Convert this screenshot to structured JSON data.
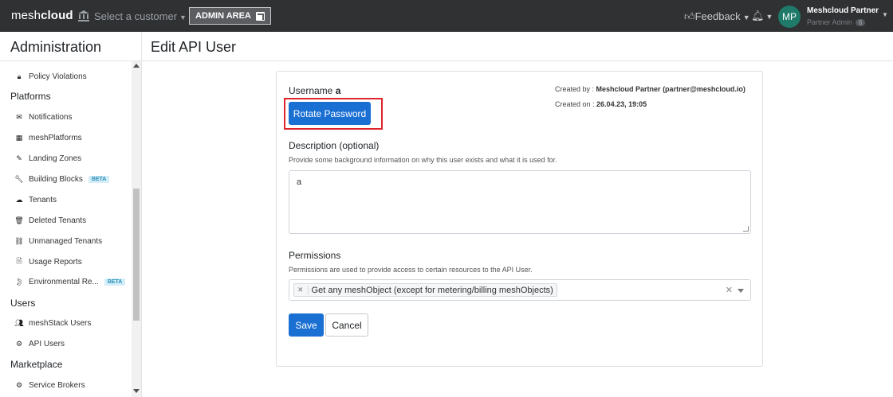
{
  "topbar": {
    "brand_light": "mesh",
    "brand_bold": "cloud",
    "customer_select": "Select a customer",
    "admin_area": "ADMIN AREA",
    "feedback": "Feedback",
    "avatar_initials": "MP",
    "user_name": "Meshcloud Partner",
    "user_role": "Partner Admin",
    "user_badge": "6",
    "bg_color": "#2f3133"
  },
  "sidebar": {
    "title": "Administration",
    "items": [
      {
        "label": "Policy Violations",
        "icon": "lock-icon"
      },
      {
        "section": "Platforms"
      },
      {
        "label": "Notifications",
        "icon": "envelope-icon"
      },
      {
        "label": "meshPlatforms",
        "icon": "grid-icon"
      },
      {
        "label": "Landing Zones",
        "icon": "edit-icon"
      },
      {
        "label": "Building Blocks",
        "icon": "wrench-icon",
        "badge": "BETA"
      },
      {
        "label": "Tenants",
        "icon": "cloud-icon"
      },
      {
        "label": "Deleted Tenants",
        "icon": "trash-icon"
      },
      {
        "label": "Unmanaged Tenants",
        "icon": "unlink-icon"
      },
      {
        "label": "Usage Reports",
        "icon": "file-icon"
      },
      {
        "label": "Environmental Re...",
        "icon": "leaf-icon",
        "badge": "BETA"
      },
      {
        "section": "Users"
      },
      {
        "label": "meshStack Users",
        "icon": "users-icon"
      },
      {
        "label": "API Users",
        "icon": "robot-icon"
      },
      {
        "section": "Marketplace"
      },
      {
        "label": "Service Brokers",
        "icon": "cogs-icon"
      }
    ]
  },
  "page": {
    "title": "Edit API User",
    "username_label": "Username",
    "username_value": "a",
    "created_by_label": "Created by :",
    "created_by_value": "Meshcloud Partner (partner@meshcloud.io)",
    "created_on_label": "Created on :",
    "created_on_value": "26.04.23, 19:05",
    "rotate_password": "Rotate Password",
    "description_label": "Description (optional)",
    "description_help": "Provide some background information on why this user exists and what it is used for.",
    "description_value": "a",
    "permissions_label": "Permissions",
    "permissions_help": "Permissions are used to provide access to certain resources to the API User.",
    "permissions_selected": [
      "Get any meshObject (except for metering/billing meshObjects)"
    ],
    "save": "Save",
    "cancel": "Cancel",
    "primary_color": "#1a6fd3",
    "highlight_color": "#e0232a"
  }
}
